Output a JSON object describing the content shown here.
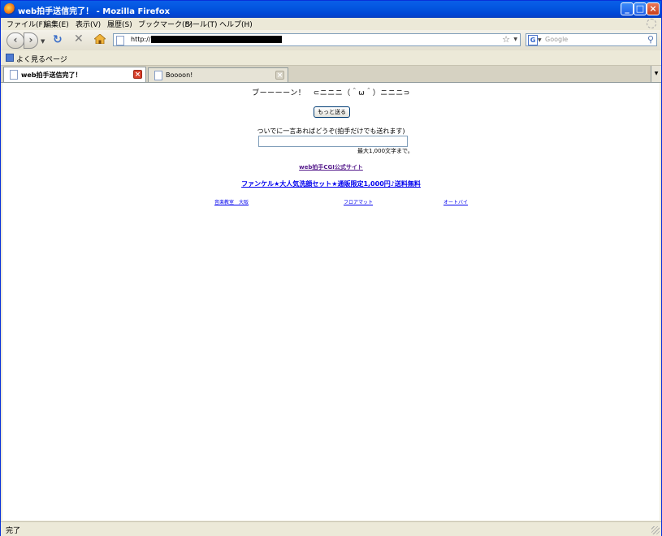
{
  "window": {
    "title": "web拍手送信完了！ - Mozilla Firefox"
  },
  "menu": {
    "items": [
      "ファイル(F)",
      "編集(E)",
      "表示(V)",
      "履歴(S)",
      "ブックマーク(B)",
      "ツール(T)",
      "ヘルプ(H)"
    ]
  },
  "nav": {
    "url": "http://",
    "search_placeholder": "Google",
    "search_engine_letter": "G"
  },
  "bookmarks": {
    "item": "よく見るページ"
  },
  "tabs": [
    {
      "label": "web拍手送信完了！"
    },
    {
      "label": "Boooon!"
    }
  ],
  "content": {
    "message": "ブーーーーン！　⊂ニニニ（＾ω＾）ニニニ⊃",
    "more_button": "もっと送る",
    "comment_prompt": "ついでに一言あればどうぞ(拍手だけでも送れます)",
    "max_note": "最大1,000文字まで。",
    "official_link": "web拍手CGI公式サイト",
    "ad_link": "ファンケル★大人気洗顔セット★通販限定1,000円♪送料無料",
    "small_links": [
      "音楽教室　大阪",
      "フロアマット",
      "オートバイ"
    ]
  },
  "status": {
    "text": "完了"
  }
}
